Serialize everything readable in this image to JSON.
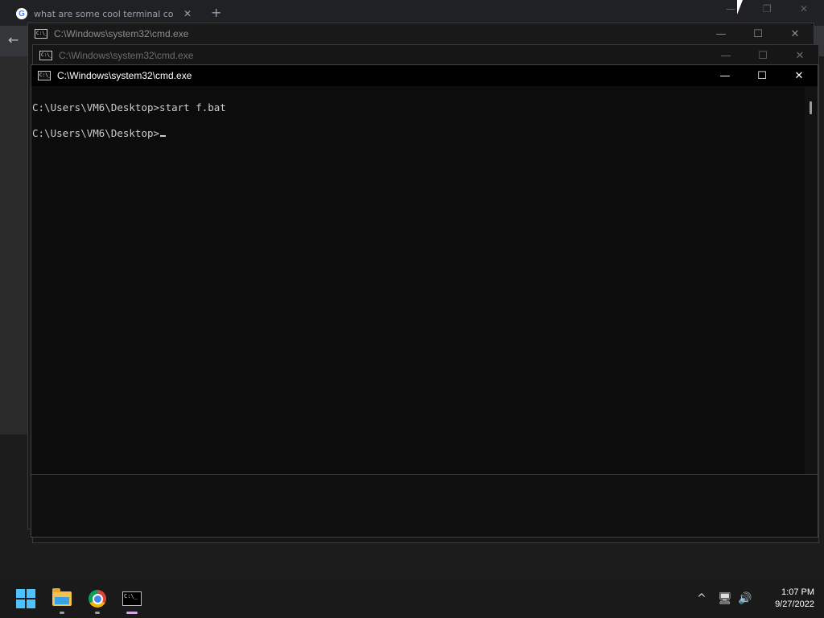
{
  "browser": {
    "tab_title": "what are some cool terminal co",
    "tab_close": "✕",
    "new_tab": "+",
    "back": "←",
    "minimize": "—",
    "restore": "❐",
    "close": "✕"
  },
  "cmd_windows": [
    {
      "title": "C:\\Windows\\system32\\cmd.exe",
      "icon_text": "C:\\_",
      "minimize": "—",
      "maximize": "☐",
      "close": "✕"
    },
    {
      "title": "C:\\Windows\\system32\\cmd.exe",
      "icon_text": "C:\\_",
      "minimize": "—",
      "maximize": "☐",
      "close": "✕"
    },
    {
      "title": "C:\\Windows\\system32\\cmd.exe",
      "icon_text": "C:\\_",
      "minimize": "—",
      "maximize": "☐",
      "close": "✕"
    }
  ],
  "console": {
    "lines": [
      "C:\\Users\\VM6\\Desktop>start f.bat",
      "C:\\Users\\VM6\\Desktop>"
    ]
  },
  "taskbar": {
    "term_icon_text": "C:\\_",
    "tray_chevron": "^",
    "tray_network": "🖥",
    "tray_volume": "🔊",
    "time": "1:07 PM",
    "date": "9/27/2022"
  },
  "colors": {
    "accent": "#4cc2ff",
    "console_bg": "#0c0c0c",
    "console_fg": "#cccccc"
  }
}
